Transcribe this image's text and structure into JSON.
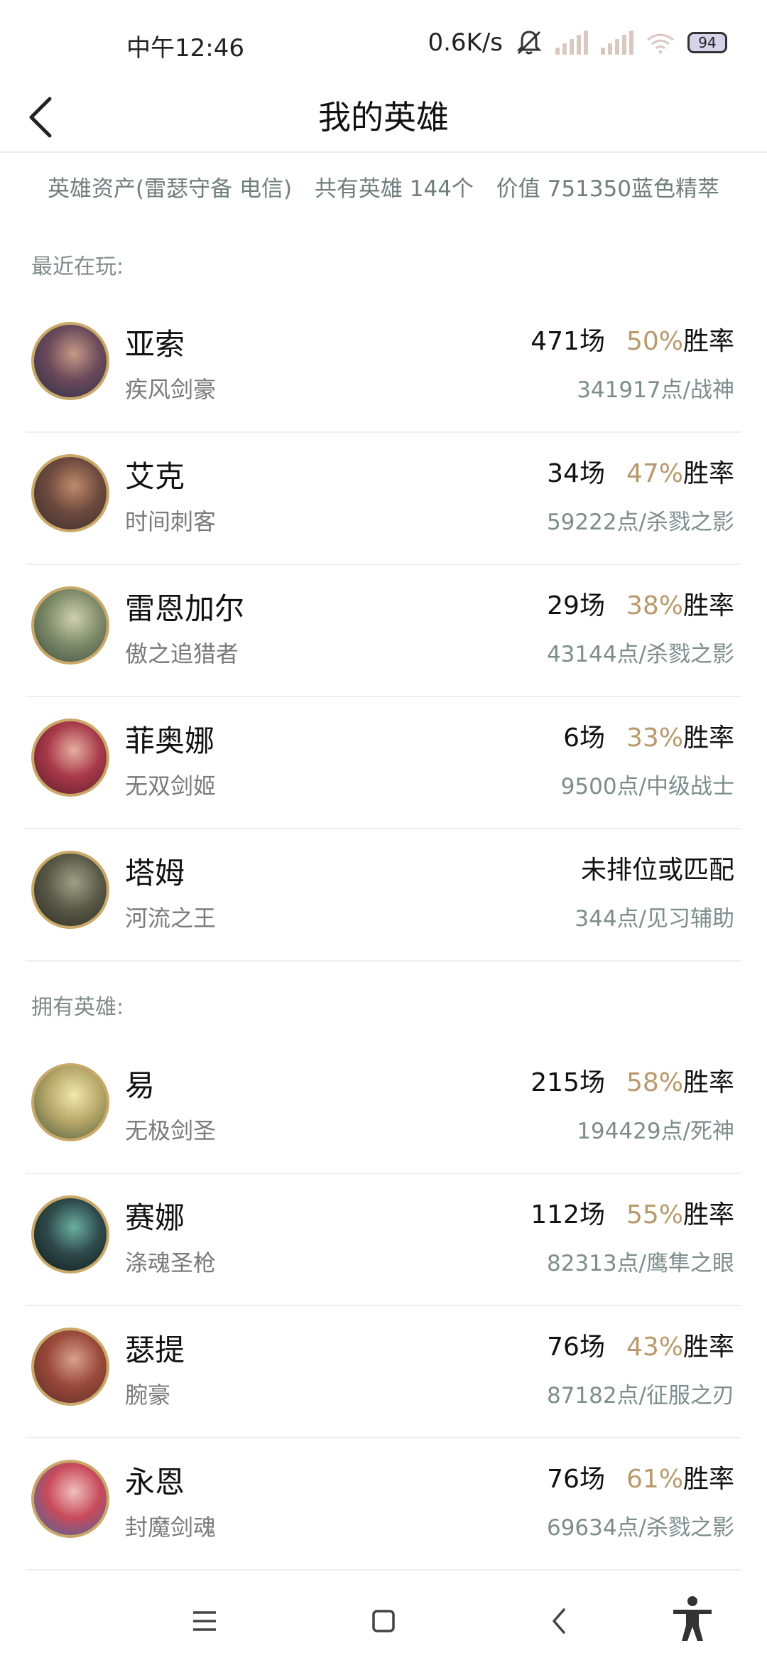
{
  "status_bar": {
    "time": "中午12:46",
    "speed": "0.6K/s",
    "battery": "94",
    "icons": [
      "bell-muted-icon",
      "signal-icon",
      "signal-icon",
      "wifi-icon",
      "battery-icon"
    ]
  },
  "header": {
    "title": "我的英雄",
    "back_icon": "chevron-left-icon"
  },
  "summary": {
    "assets": "英雄资产(雷瑟守备 电信)",
    "count": "共有英雄 144个",
    "value": "价值 751350蓝色精萃"
  },
  "sections": {
    "recent_label": "最近在玩:",
    "owned_label": "拥有英雄:"
  },
  "colors": {
    "win_rate": "#b8996b",
    "muted_text": "#7c8d8c",
    "avatar_border": "#c9a868"
  },
  "recent_heroes": [
    {
      "name": "亚索",
      "title": "疾风剑豪",
      "games": "471场",
      "rate": "50%",
      "rate_suffix": "胜率",
      "points": "341917点/战神"
    },
    {
      "name": "艾克",
      "title": "时间刺客",
      "games": "34场",
      "rate": "47%",
      "rate_suffix": "胜率",
      "points": "59222点/杀戮之影"
    },
    {
      "name": "雷恩加尔",
      "title": "傲之追猎者",
      "games": "29场",
      "rate": "38%",
      "rate_suffix": "胜率",
      "points": "43144点/杀戮之影"
    },
    {
      "name": "菲奥娜",
      "title": "无双剑姬",
      "games": "6场",
      "rate": "33%",
      "rate_suffix": "胜率",
      "points": "9500点/中级战士"
    },
    {
      "name": "塔姆",
      "title": "河流之王",
      "games": "",
      "rate": "",
      "rate_suffix": "未排位或匹配",
      "points": "344点/见习辅助"
    }
  ],
  "owned_heroes": [
    {
      "name": "易",
      "title": "无极剑圣",
      "games": "215场",
      "rate": "58%",
      "rate_suffix": "胜率",
      "points": "194429点/死神"
    },
    {
      "name": "赛娜",
      "title": "涤魂圣枪",
      "games": "112场",
      "rate": "55%",
      "rate_suffix": "胜率",
      "points": "82313点/鹰隼之眼"
    },
    {
      "name": "瑟提",
      "title": "腕豪",
      "games": "76场",
      "rate": "43%",
      "rate_suffix": "胜率",
      "points": "87182点/征服之刃"
    },
    {
      "name": "永恩",
      "title": "封魔剑魂",
      "games": "76场",
      "rate": "61%",
      "rate_suffix": "胜率",
      "points": "69634点/杀戮之影"
    }
  ],
  "bottom_nav": {
    "icons": [
      "menu-icon",
      "home-square-icon",
      "back-icon",
      "accessibility-icon"
    ]
  }
}
